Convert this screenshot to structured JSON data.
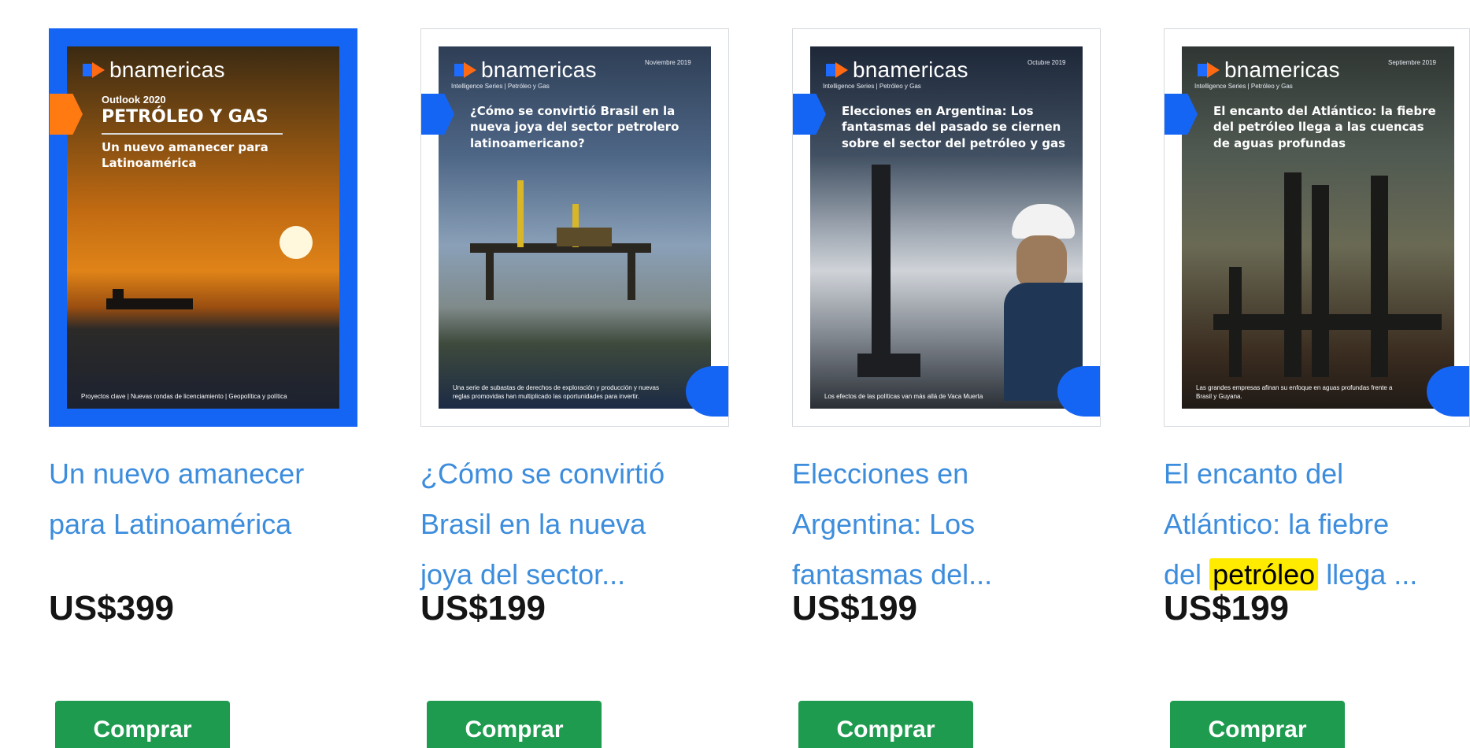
{
  "colors": {
    "link": "#3d8ddd",
    "accent_blue": "#1565f5",
    "buy_green": "#1f9b4f",
    "highlight": "#ffeb00"
  },
  "products": [
    {
      "brand": "bnamericas",
      "cover_kicker": "Outlook 2020",
      "cover_heading": "PETRÓLEO Y GAS",
      "cover_sub": "Un nuevo amanecer para Latinoamérica",
      "cover_footer": "Proyectos clave  |  Nuevas rondas de licenciamiento  |  Geopolítica y política",
      "title": "Un nuevo amanecer para Latinoamérica",
      "price": "US$399",
      "buy_label": "Comprar"
    },
    {
      "brand": "bnamericas",
      "series": "Intelligence Series | Petróleo y Gas",
      "date": "Noviembre 2019",
      "cover_heading": "¿Cómo se convirtió Brasil en la nueva joya del sector petrolero latinoamericano?",
      "cover_footer": "Una serie de subastas de derechos de exploración y producción y nuevas reglas promovidas han multiplicado las oportunidades para invertir.",
      "title_line1": "¿Cómo se convirtió",
      "title_line2": "Brasil en la nueva",
      "title_line3": "joya del sector...",
      "price": "US$199",
      "buy_label": "Comprar"
    },
    {
      "brand": "bnamericas",
      "series": "Intelligence Series | Petróleo y Gas",
      "date": "Octubre 2019",
      "cover_heading": "Elecciones en Argentina: Los fantasmas del pasado se ciernen sobre el sector del petróleo y gas",
      "cover_footer": "Los efectos de las políticas van más allá de Vaca Muerta",
      "title_line1": "Elecciones en",
      "title_line2": "Argentina: Los",
      "title_line3": "fantasmas del...",
      "price": "US$199",
      "buy_label": "Comprar"
    },
    {
      "brand": "bnamericas",
      "series": "Intelligence Series | Petróleo y Gas",
      "date": "Septiembre 2019",
      "cover_heading": "El encanto del Atlántico: la fiebre del petróleo llega a las cuencas de aguas profundas",
      "cover_footer": "Las grandes empresas afinan su enfoque en aguas profundas frente a Brasil y Guyana.",
      "title_line1": "El encanto del",
      "title_line2": "Atlántico: la fiebre",
      "title_line3_pre": "del",
      "title_line3_hl": "petróleo",
      "title_line3_post": "llega ...",
      "price": "US$199",
      "buy_label": "Comprar"
    }
  ]
}
